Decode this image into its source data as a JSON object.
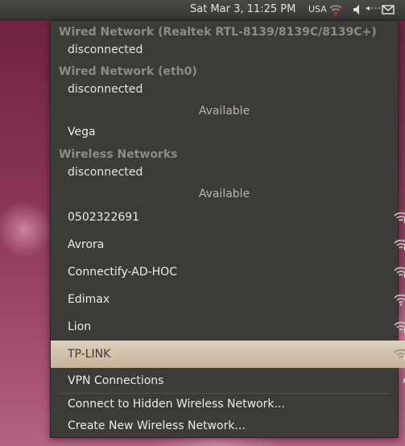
{
  "panel": {
    "datetime": "Sat Mar  3, 11:25 PM",
    "keyboard_layout": "USA",
    "volume_label": "◂---",
    "icons": [
      "network-wireless-icon",
      "volume-icon",
      "mail-icon"
    ]
  },
  "menu": {
    "wired1": {
      "header": "Wired Network (Realtek RTL-8139/8139C/8139C+)",
      "status": "disconnected"
    },
    "wired2": {
      "header": "Wired Network (eth0)",
      "status": "disconnected"
    },
    "wired_available": "Available",
    "wired_networks": [
      "Vega"
    ],
    "wireless": {
      "header": "Wireless Networks",
      "status": "disconnected"
    },
    "wireless_available": "Available",
    "wireless_networks": [
      {
        "name": "0502322691",
        "secured": true
      },
      {
        "name": "Avrora",
        "secured": true
      },
      {
        "name": "Connectify-AD-HOC",
        "secured": true
      },
      {
        "name": "Edimax",
        "secured": false
      },
      {
        "name": "Lion",
        "secured": true
      },
      {
        "name": "TP-LINK",
        "secured": true,
        "highlighted": true
      }
    ],
    "vpn": "VPN Connections",
    "connect_hidden": "Connect to Hidden Wireless Network...",
    "create_new": "Create New Wireless Network..."
  },
  "colors": {
    "menu_bg": "#3c3b37",
    "highlight": "#d6c8b2",
    "header_text": "#8c8b85"
  }
}
